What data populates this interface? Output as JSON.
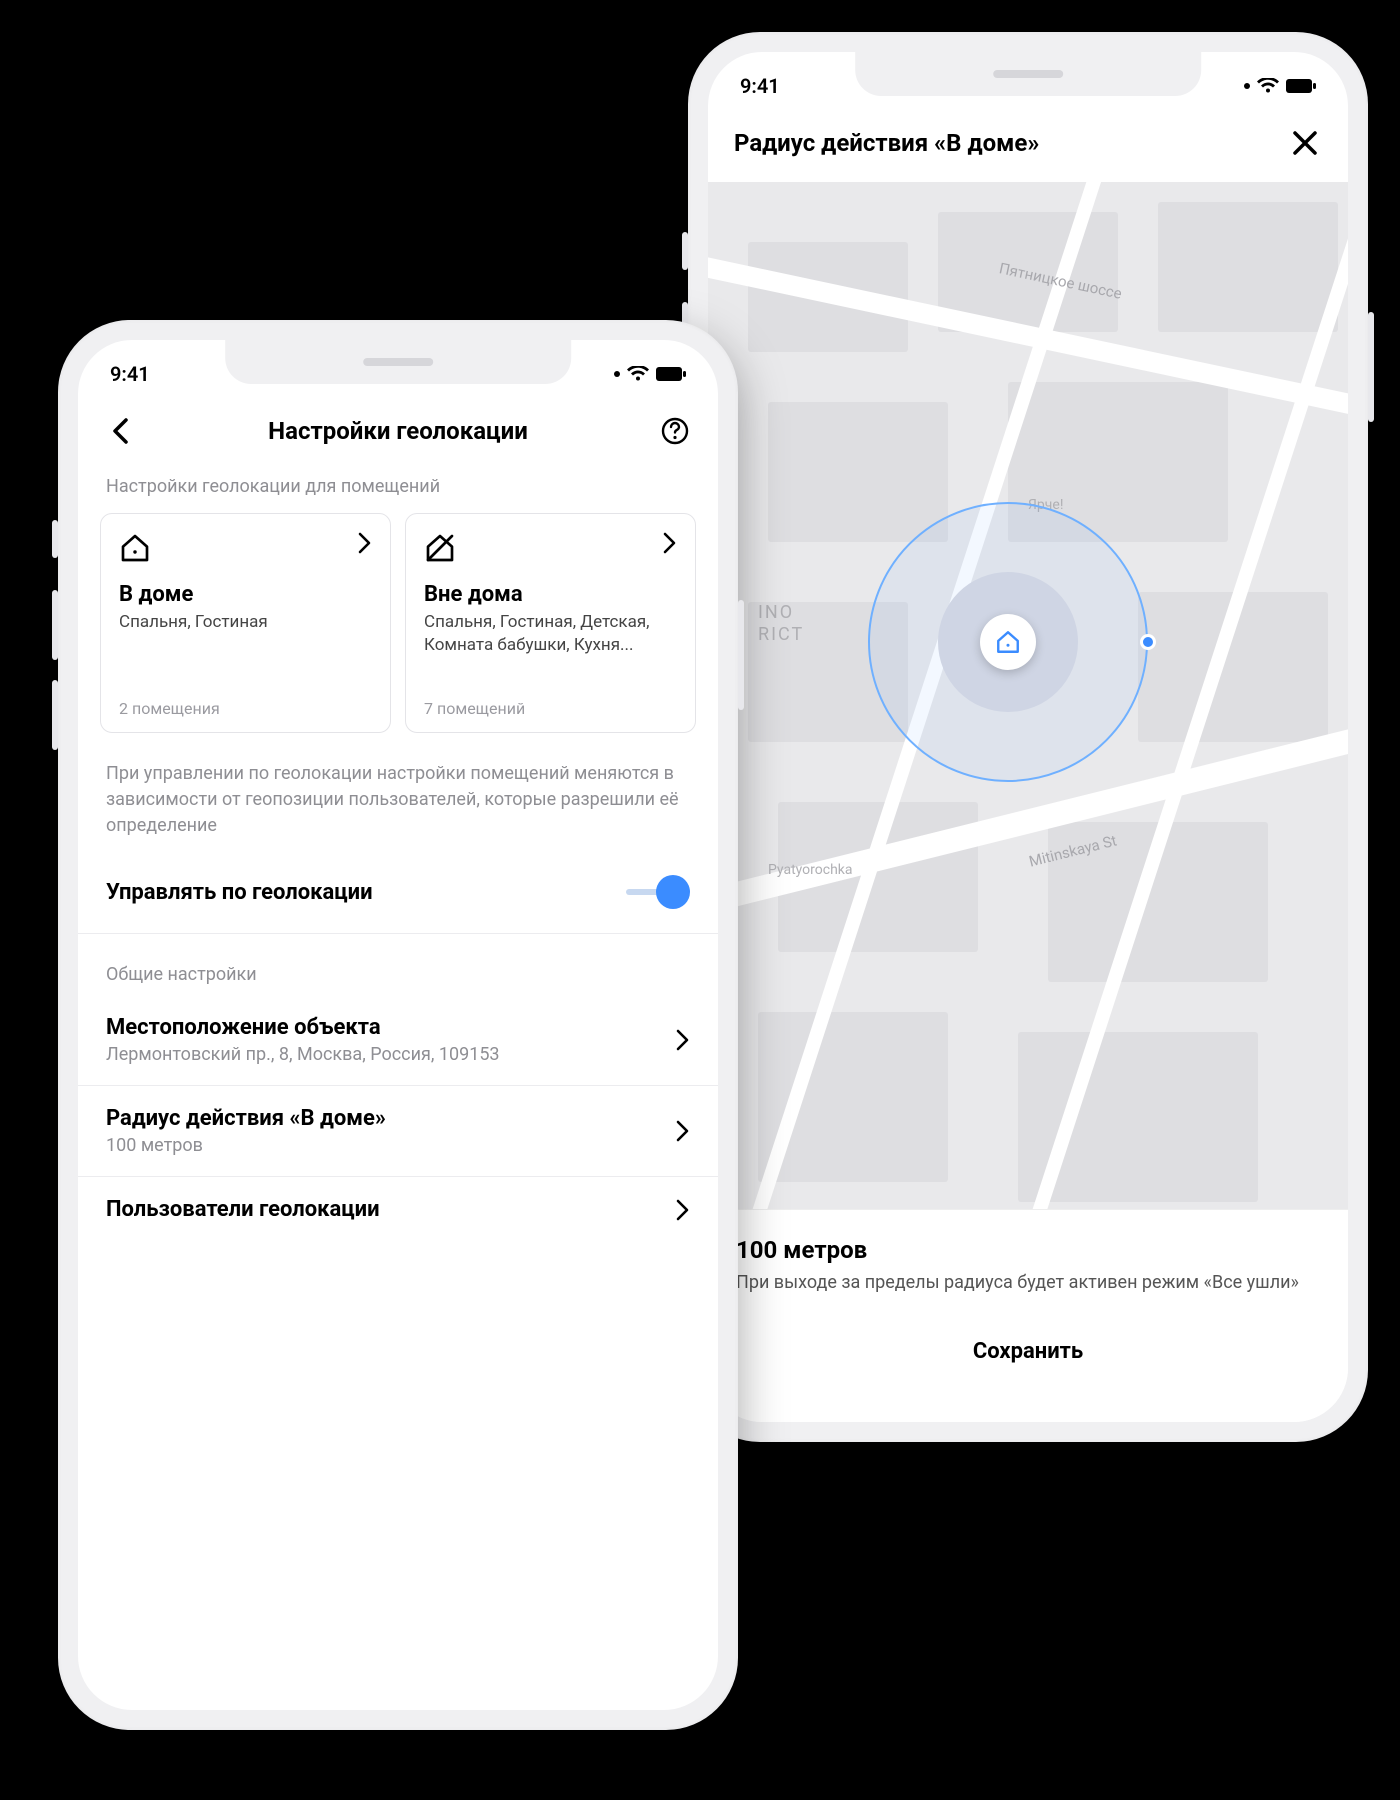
{
  "status": {
    "time": "9:41"
  },
  "left": {
    "header": {
      "title": "Настройки геолокации"
    },
    "section_rooms_label": "Настройки геолокации для помещений",
    "cards": {
      "home": {
        "title": "В доме",
        "subtitle": "Спальня, Гостиная",
        "footer": "2 помещения"
      },
      "away": {
        "title": "Вне дома",
        "subtitle": "Спальня, Гостиная, Детская, Комната бабушки, Кухня...",
        "footer": "7 помещений"
      }
    },
    "info_text": "При управлении по геолокации настройки помещений меняются в зависимости от геопозиции пользователей, которые разрешили её определение",
    "toggle": {
      "label": "Управлять по геолокации",
      "on": true
    },
    "general_label": "Общие настройки",
    "rows": {
      "location": {
        "title": "Местоположение объекта",
        "subtitle": "Лермонтовский пр., 8, Москва, Россия, 109153"
      },
      "radius": {
        "title": "Радиус действия «В доме»",
        "subtitle": "100 метров"
      },
      "users": {
        "title": "Пользователи геолокации"
      }
    }
  },
  "right": {
    "header": {
      "title": "Радиус действия «В доме»"
    },
    "map": {
      "street1": "Пятницкое шоссе",
      "street2": "Mitinskaya St",
      "poi1": "Ярче!",
      "poi2": "Pyatyorochka",
      "district1": "INO",
      "district2": "RICT"
    },
    "panel": {
      "distance": "100 метров",
      "description": "При выходе за пределы радиуса будет активен режим «Все ушли»",
      "save": "Сохранить"
    }
  }
}
